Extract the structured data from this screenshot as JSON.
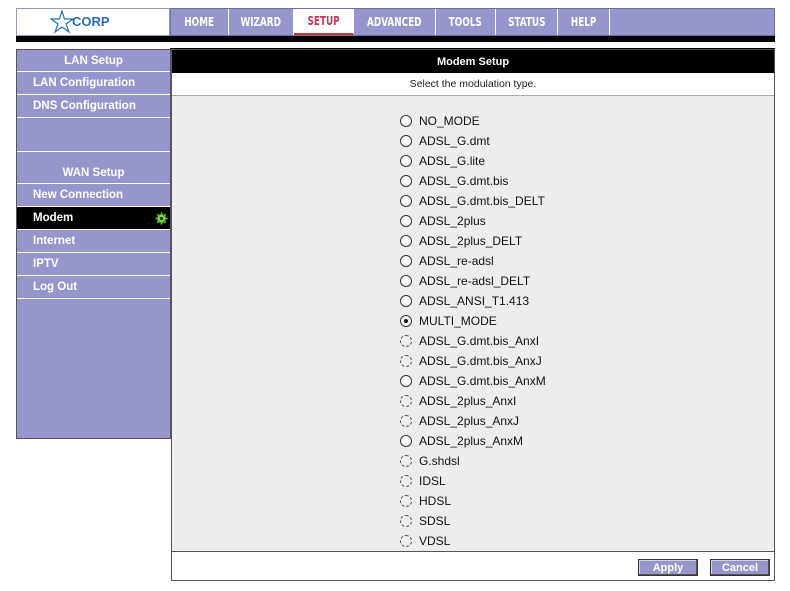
{
  "logo": {
    "text": "CORP"
  },
  "nav": {
    "tabs": [
      {
        "label": "HOME",
        "width": 58
      },
      {
        "label": "WIZARD",
        "width": 65
      },
      {
        "label": "SETUP",
        "width": 60,
        "active": true
      },
      {
        "label": "ADVANCED",
        "width": 82
      },
      {
        "label": "TOOLS",
        "width": 60
      },
      {
        "label": "STATUS",
        "width": 62
      },
      {
        "label": "HELP",
        "width": 52
      }
    ]
  },
  "sidebar": {
    "lan_heading": "LAN Setup",
    "lan_items": [
      "LAN Configuration",
      "DNS Configuration"
    ],
    "wan_heading": "WAN Setup",
    "wan_items": [
      "New Connection",
      "Modem",
      "Internet",
      "IPTV",
      "Log Out"
    ],
    "active_item": "Modem"
  },
  "main": {
    "title": "Modem Setup",
    "subtitle": "Select the modulation type.",
    "options": [
      {
        "label": "NO_MODE",
        "state": "enabled"
      },
      {
        "label": "ADSL_G.dmt",
        "state": "enabled"
      },
      {
        "label": "ADSL_G.lite",
        "state": "enabled"
      },
      {
        "label": "ADSL_G.dmt.bis",
        "state": "enabled"
      },
      {
        "label": "ADSL_G.dmt.bis_DELT",
        "state": "enabled"
      },
      {
        "label": "ADSL_2plus",
        "state": "enabled"
      },
      {
        "label": "ADSL_2plus_DELT",
        "state": "enabled"
      },
      {
        "label": "ADSL_re-adsl",
        "state": "enabled"
      },
      {
        "label": "ADSL_re-adsl_DELT",
        "state": "enabled"
      },
      {
        "label": "ADSL_ANSI_T1.413",
        "state": "enabled"
      },
      {
        "label": "MULTI_MODE",
        "state": "checked"
      },
      {
        "label": "ADSL_G.dmt.bis_AnxI",
        "state": "disabled"
      },
      {
        "label": "ADSL_G.dmt.bis_AnxJ",
        "state": "disabled"
      },
      {
        "label": "ADSL_G.dmt.bis_AnxM",
        "state": "enabled"
      },
      {
        "label": "ADSL_2plus_AnxI",
        "state": "disabled"
      },
      {
        "label": "ADSL_2plus_AnxJ",
        "state": "disabled"
      },
      {
        "label": "ADSL_2plus_AnxM",
        "state": "enabled"
      },
      {
        "label": "G.shdsl",
        "state": "disabled"
      },
      {
        "label": "IDSL",
        "state": "disabled"
      },
      {
        "label": "HDSL",
        "state": "disabled"
      },
      {
        "label": "SDSL",
        "state": "disabled"
      },
      {
        "label": "VDSL",
        "state": "disabled"
      }
    ],
    "apply_label": "Apply",
    "cancel_label": "Cancel"
  },
  "colors": {
    "accent": "#9696cc",
    "active_tab_text": "#c0395a",
    "header_bg": "#000000"
  }
}
